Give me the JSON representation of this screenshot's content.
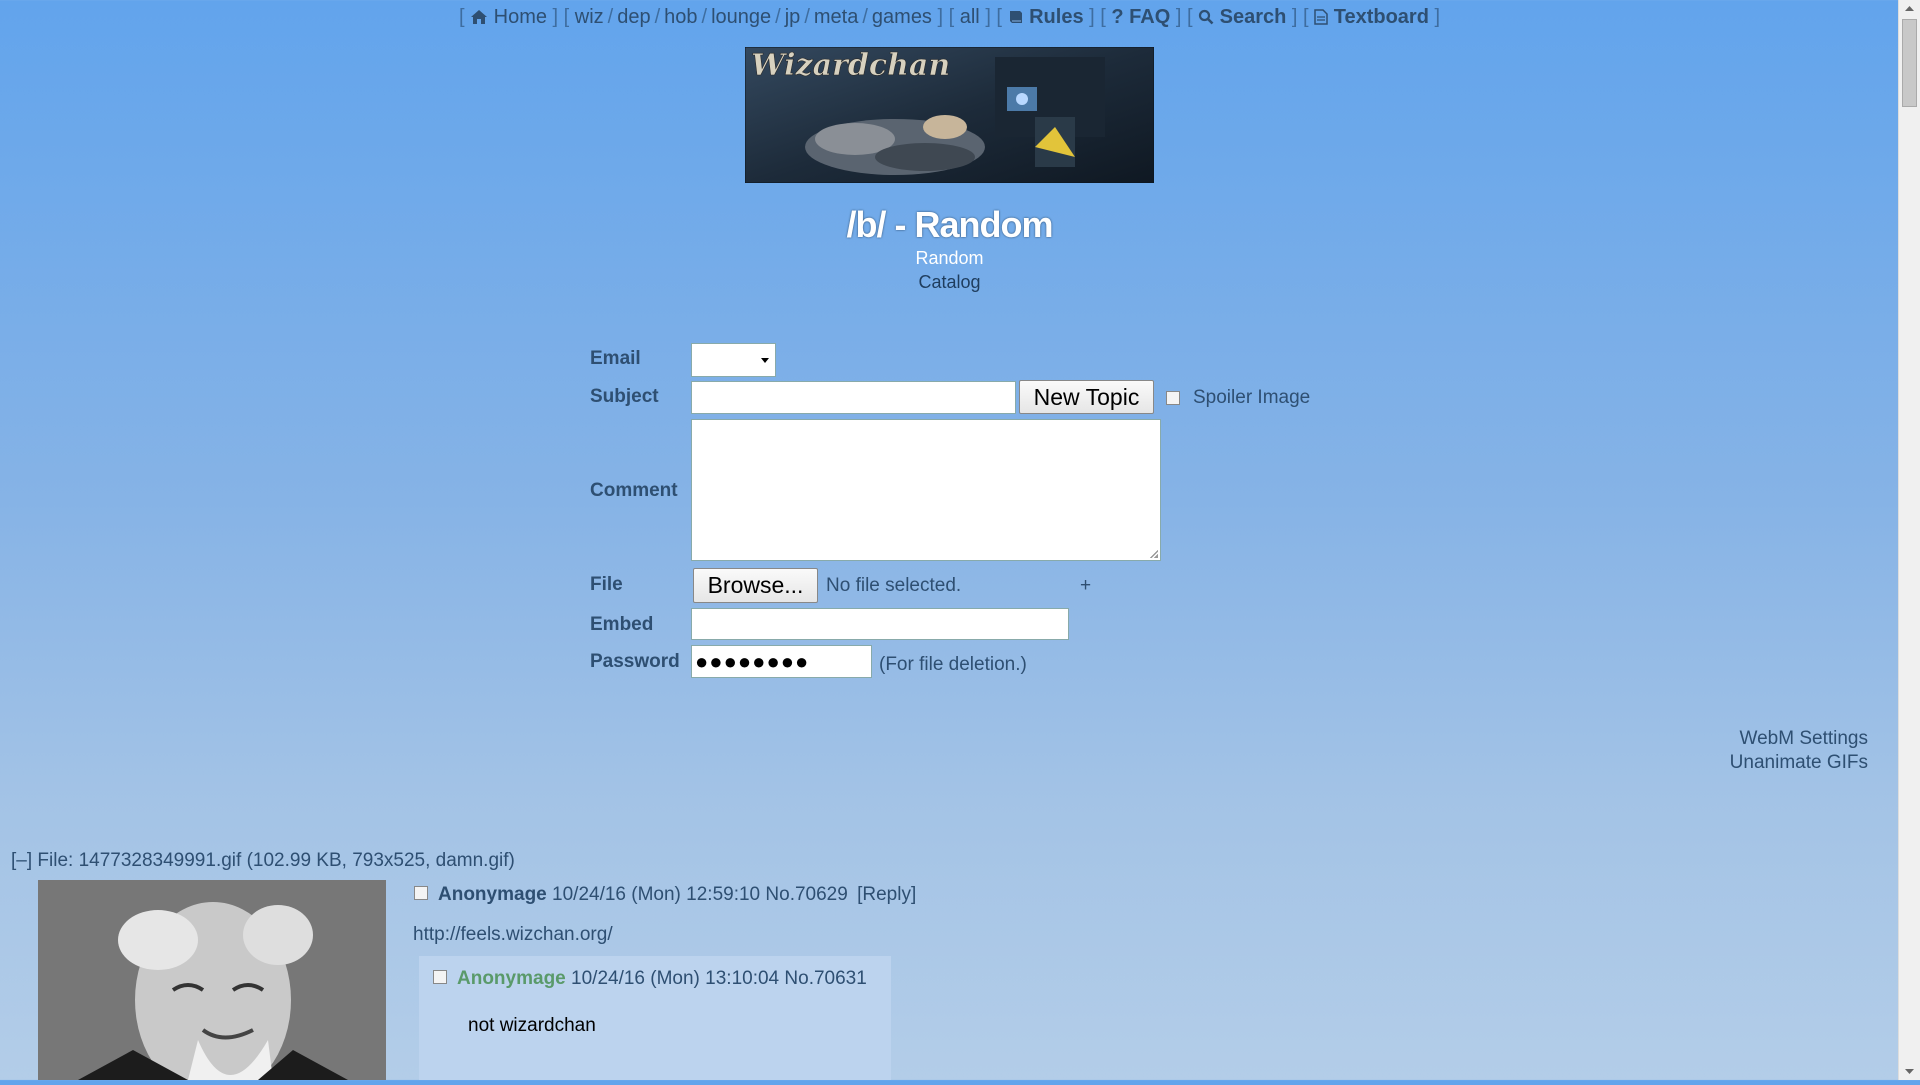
{
  "nav": {
    "home": "Home",
    "boards": [
      "wiz",
      "dep",
      "hob",
      "lounge",
      "jp",
      "meta",
      "games"
    ],
    "all": "all",
    "rules": "Rules",
    "faq": "FAQ",
    "search": "Search",
    "textboard": "Textboard"
  },
  "banner": {
    "logo_text": "Wizardchan"
  },
  "board": {
    "title": "/b/ - Random",
    "subtitle": "Random",
    "catalog": "Catalog"
  },
  "form": {
    "email_label": "Email",
    "subject_label": "Subject",
    "new_topic": "New Topic",
    "spoiler_label": "Spoiler Image",
    "comment_label": "Comment",
    "file_label": "File",
    "browse": "Browse...",
    "no_file": "No file selected.",
    "add_more": "+",
    "embed_label": "Embed",
    "password_label": "Password",
    "password_value": "●●●●●●●●",
    "password_note": "(For file deletion.)"
  },
  "settings": {
    "webm": "WebM Settings",
    "unanimate": "Unanimate GIFs"
  },
  "thread": {
    "file_info": "[–] File: 1477328349991.gif (102.99 KB, 793x525, damn.gif)",
    "op": {
      "name": "Anonymage",
      "date": "10/24/16 (Mon) 12:59:10",
      "no": "No.70629",
      "reply_link": "[Reply]",
      "body": "http://feels.wizchan.org/"
    },
    "replies": [
      {
        "name": "Anonymage",
        "date": "10/24/16 (Mon) 13:10:04",
        "no": "No.70631",
        "body": "not wizardchan"
      }
    ]
  },
  "colors": {
    "bg_top": "#62a4ec",
    "bg_bottom": "#b3cde8",
    "text": "#2e4f72",
    "reply_bg": "#bcd3ee",
    "reply_name": "#5a9a6a"
  }
}
